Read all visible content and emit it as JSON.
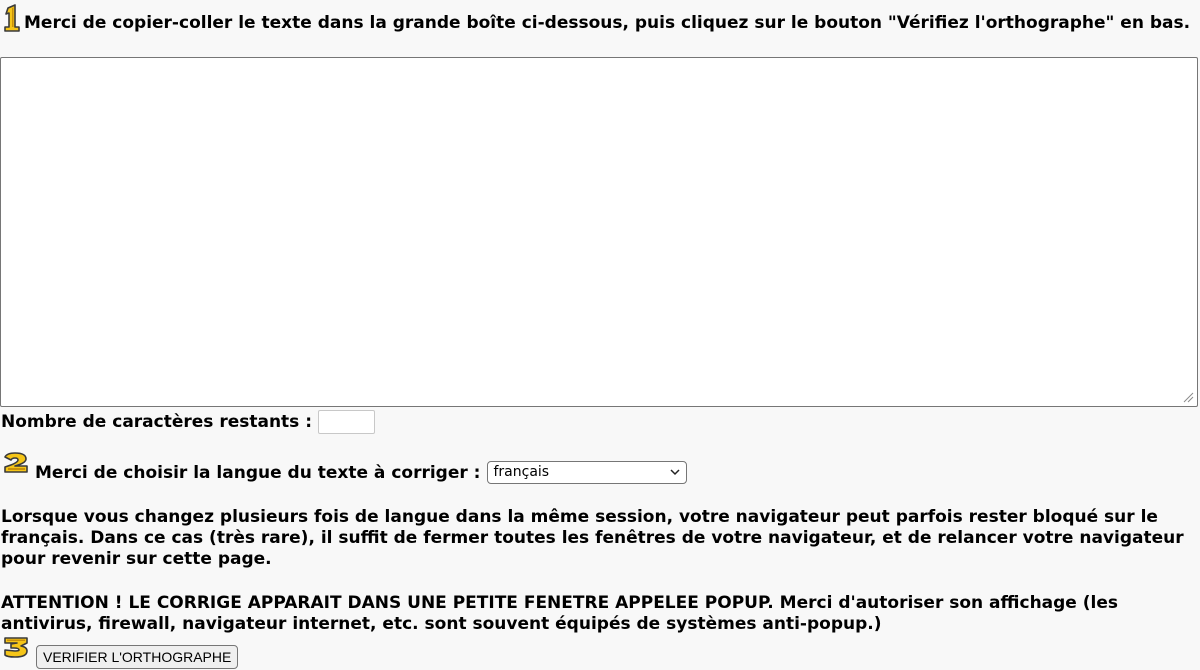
{
  "step1": {
    "number": "1",
    "instruction": "Merci de copier-coller le texte dans la grande boîte ci-dessous, puis cliquez sur le bouton \"Vérifiez l'orthographe\" en bas."
  },
  "text_box": {
    "value": ""
  },
  "remaining": {
    "label": "Nombre de caractères restants :",
    "value": ""
  },
  "step2": {
    "number": "2",
    "label": "Merci de choisir la langue du texte à corriger :",
    "selected_language": "français"
  },
  "info_paragraph": "Lorsque vous changez plusieurs fois de langue dans la même session, votre navigateur peut parfois rester bloqué sur le français. Dans ce cas (très rare), il suffit de fermer toutes les fenêtres de votre navigateur, et de relancer votre navigateur pour revenir sur cette page.",
  "warning_paragraph": "ATTENTION ! LE CORRIGE APPARAIT DANS UNE PETITE FENETRE APPELEE POPUP. Merci d'autoriser son affichage (les antivirus, firewall, navigateur internet, etc. sont souvent équipés de systèmes anti-popup.)",
  "step3": {
    "number": "3",
    "button_label": "VERIFIER L'ORTHOGRAPHE"
  },
  "colors": {
    "step_icon_fill": "#f5c518",
    "step_icon_shade": "#c8900a",
    "step_icon_outline": "#3a3a3a",
    "page_background": "#f8f8f8"
  }
}
